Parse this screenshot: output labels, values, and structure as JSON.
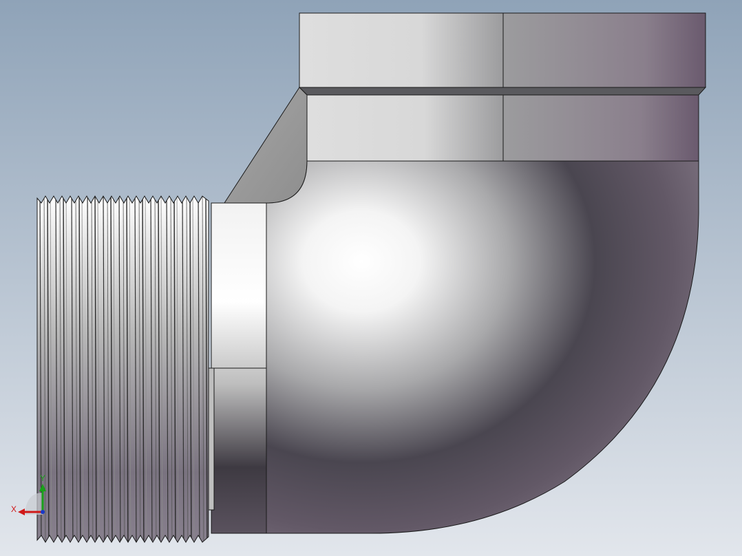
{
  "viewport": {
    "background_top": "#8fa3b8",
    "background_bottom": "#e2e6ec",
    "model_name": "pipe-street-elbow-90",
    "model_tone_light": "#ffffff",
    "model_tone_mid": "#bdbdbd",
    "model_tone_dark": "#4a4650",
    "model_tone_purple": "#6a5a6e",
    "edge_color": "#1a1a1a"
  },
  "triad": {
    "x_label": "X",
    "y_label": "Y",
    "x_color": "#d01818",
    "y_color": "#18a018",
    "z_color": "#1838c8"
  }
}
